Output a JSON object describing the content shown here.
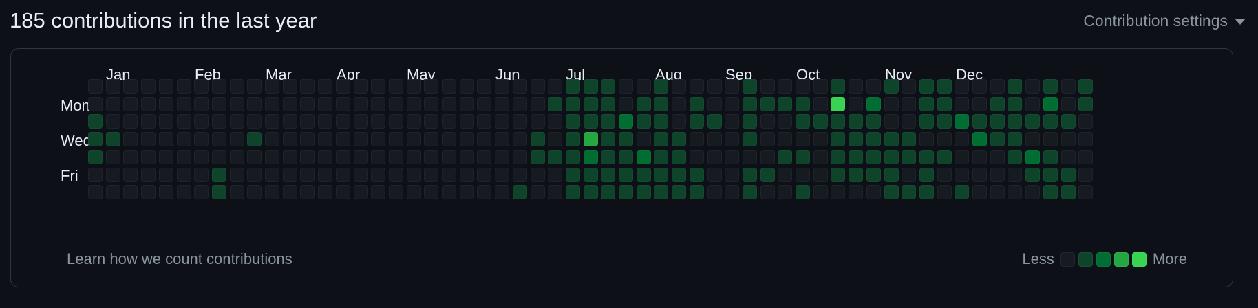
{
  "header": {
    "title": "185 contributions in the last year",
    "settings_label": "Contribution settings",
    "settings_icon": "caret-down-icon"
  },
  "calendar": {
    "months": [
      "Jan",
      "Feb",
      "Mar",
      "Apr",
      "May",
      "Jun",
      "Jul",
      "Aug",
      "Sep",
      "Oct",
      "Nov",
      "Dec"
    ],
    "days": [
      "Mon",
      "Wed",
      "Fri"
    ],
    "level_colors": [
      "#161b22",
      "#0e4429",
      "#006d32",
      "#26a641",
      "#39d353"
    ],
    "grid": [
      "000000000000000000000000000111001000010000100101100010101",
      "000000000000000000000000001111011010011110402001100110201",
      "100000000000000000000000000111211011010011111001121111110",
      "110000000100000000000000010131101100010000111110002110000",
      "100000000000000000000000011121121100000110111111100012100",
      "000000010000000000000000000111111110011000111101000001110",
      "000000010000000000000000100111111110010010000111010000110"
    ]
  },
  "footer": {
    "link_label": "Learn how we count contributions",
    "legend_less": "Less",
    "legend_more": "More"
  }
}
